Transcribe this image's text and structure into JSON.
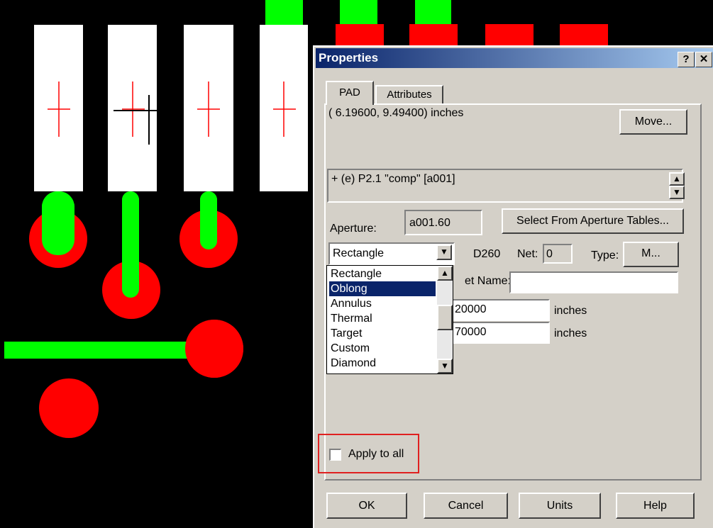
{
  "dialog": {
    "title": "Properties",
    "help_button": "?",
    "close_button": "✕",
    "tabs": [
      {
        "label": "PAD",
        "active": true
      },
      {
        "label": "Attributes",
        "active": false
      }
    ],
    "coordinates": "( 6.19600,  9.49400) inches",
    "move_button": "Move...",
    "info_text": "+ (e) P2.1 \"comp\" [a001]",
    "aperture_label": "Aperture:",
    "aperture_value": "a001.60",
    "select_aperture_button": "Select From Aperture Tables...",
    "shape_selected": "Rectangle",
    "dcode": "D260",
    "net_label": "Net:",
    "net_value": "0",
    "type_label": "Type:",
    "type_button": "M...",
    "net_name_label": "et Name:",
    "net_name_value": "",
    "width_value": "20000",
    "width_unit": "inches",
    "height_value": "70000",
    "height_unit": "inches",
    "shape_options": [
      "Rectangle",
      "Oblong",
      "Annulus",
      "Thermal",
      "Target",
      "Custom",
      "Diamond"
    ],
    "highlighted_option": "Oblong",
    "apply_to_all_label": "Apply to all",
    "apply_to_all_checked": false,
    "ok_button": "OK",
    "cancel_button": "Cancel",
    "units_button": "Units",
    "help_footer_button": "Help"
  },
  "colors": {
    "pad_fill": "#ffffff",
    "trace": "#00ff00",
    "copper": "#ff0000",
    "background": "#000000",
    "crosshair": "#ff0000"
  }
}
